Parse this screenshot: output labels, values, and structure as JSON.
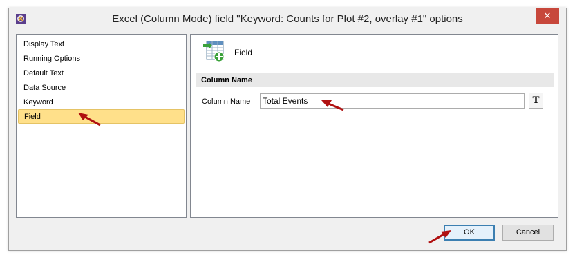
{
  "window": {
    "title": "Excel (Column Mode) field \"Keyword: Counts for Plot #2, overlay #1\" options",
    "close_glyph": "✕"
  },
  "sidebar": {
    "items": [
      {
        "label": "Display Text",
        "selected": false
      },
      {
        "label": "Running Options",
        "selected": false
      },
      {
        "label": "Default Text",
        "selected": false
      },
      {
        "label": "Data Source",
        "selected": false
      },
      {
        "label": "Keyword",
        "selected": false
      },
      {
        "label": "Field",
        "selected": true
      }
    ]
  },
  "panel": {
    "heading": "Field",
    "icon": "table-field-icon",
    "section_title": "Column Name",
    "column_name_label": "Column Name",
    "column_name_value": "Total Events",
    "format_button_label": "T"
  },
  "buttons": {
    "ok_label": "OK",
    "cancel_label": "Cancel"
  },
  "colors": {
    "selection": "#ffe08a",
    "close_button": "#c7473b",
    "annotation_arrow": "#b01010"
  }
}
